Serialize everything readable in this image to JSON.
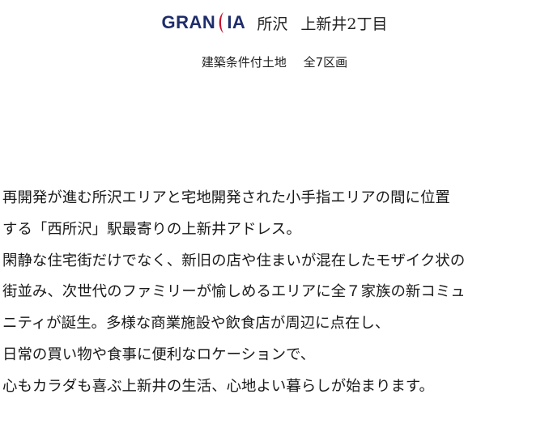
{
  "header": {
    "logo_text_left": "GRAN",
    "logo_text_right": "IA",
    "logo_accent_color": "#c8102e",
    "logo_color": "#1f2d6b",
    "place": "所沢",
    "address": "上新井2丁目"
  },
  "subtitle": {
    "category": "建築条件付土地",
    "lots": "全7区画"
  },
  "body_lines": [
    "再開発が進む所沢エリアと宅地開発された小手指エリアの間に位置",
    "する「西所沢」駅最寄りの上新井アドレス。",
    "閑静な住宅街だけでなく、新旧の店や住まいが混在したモザイク状の",
    "街並み、次世代のファミリーが愉しめるエリアに全７家族の新コミュ",
    "ニティが誕生。多様な商業施設や飲食店が周辺に点在し、",
    "日常の買い物や食事に便利なロケーションで、",
    "心もカラダも喜ぶ上新井の生活、心地よい暮らしが始まります。"
  ]
}
